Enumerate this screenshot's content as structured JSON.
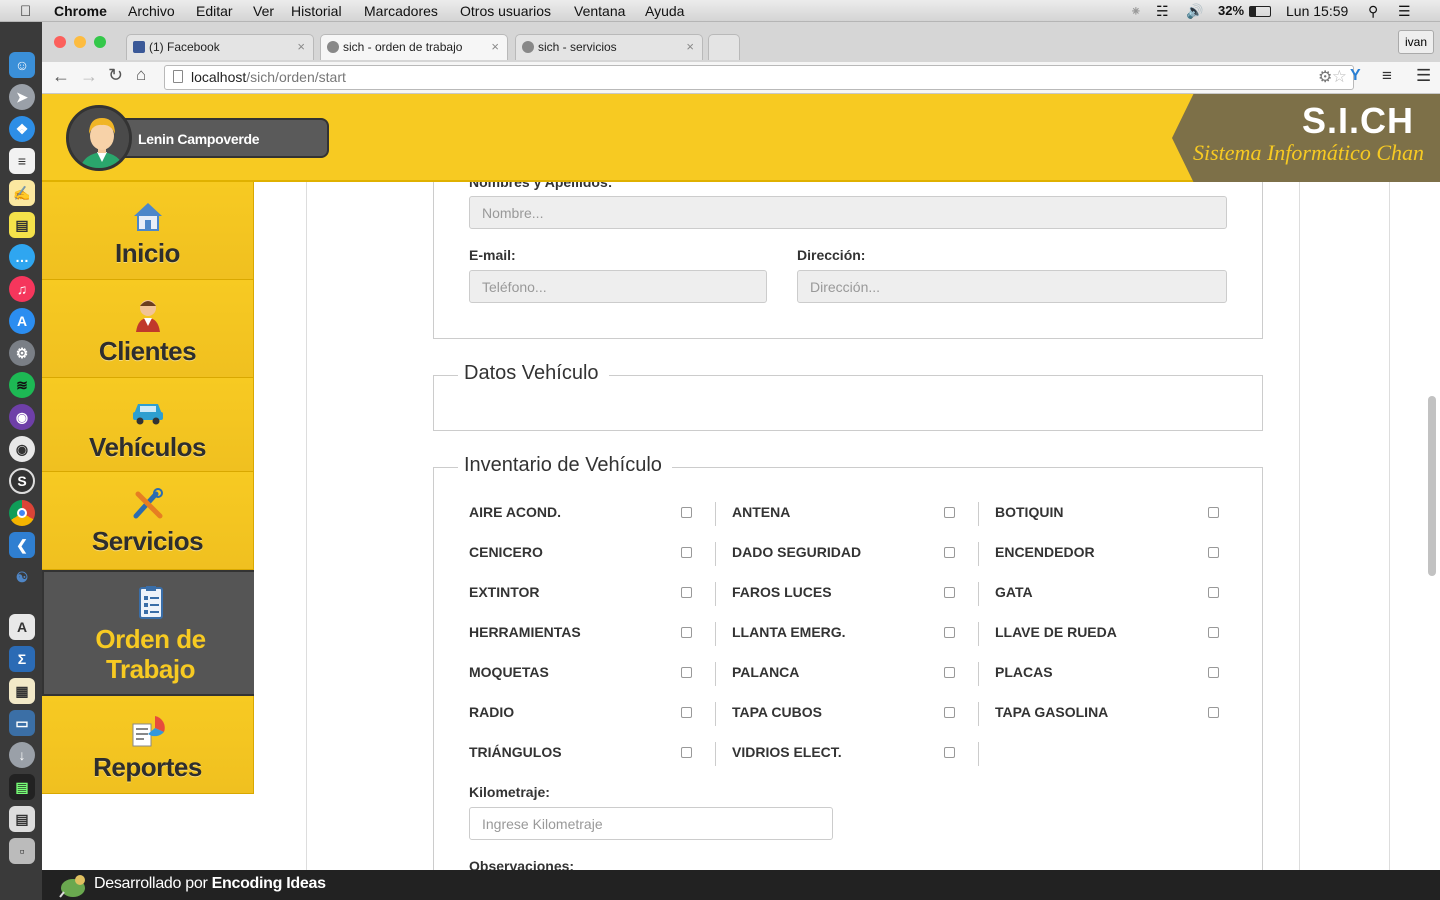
{
  "menubar": {
    "app": "Chrome",
    "menus": [
      "Archivo",
      "Editar",
      "Ver",
      "Historial",
      "Marcadores",
      "Otros usuarios",
      "Ventana",
      "Ayuda"
    ],
    "battery": "32%",
    "clock": "Lun 15:59"
  },
  "browser": {
    "tabs": [
      {
        "title": "(1) Facebook"
      },
      {
        "title": "sich - orden de trabajo"
      },
      {
        "title": "sich - servicios"
      }
    ],
    "profile": "ivan",
    "url_host": "localhost",
    "url_path": "/sich/orden/start"
  },
  "header": {
    "user_name": "Lenin Campoverde",
    "brand_title": "S.I.CH",
    "brand_subtitle": "Sistema Informático Chan"
  },
  "sidebar": {
    "items": [
      {
        "label": "Inicio"
      },
      {
        "label": "Clientes"
      },
      {
        "label": "Vehículos"
      },
      {
        "label": "Servicios"
      },
      {
        "label": "Orden de Trabajo"
      },
      {
        "label": "Reportes"
      }
    ]
  },
  "form": {
    "names_label": "Nombres y Apellidos:",
    "names_placeholder": "Nombre...",
    "email_label": "E-mail:",
    "email_placeholder": "Teléfono...",
    "address_label": "Dirección:",
    "address_placeholder": "Dirección...",
    "vehicle_legend": "Datos Vehículo",
    "inventory_legend": "Inventario de Vehículo",
    "inventory": [
      [
        "AIRE ACOND.",
        "ANTENA",
        "BOTIQUIN"
      ],
      [
        "CENICERO",
        "DADO SEGURIDAD",
        "ENCENDEDOR"
      ],
      [
        "EXTINTOR",
        "FAROS LUCES",
        "GATA"
      ],
      [
        "HERRAMIENTAS",
        "LLANTA EMERG.",
        "LLAVE DE RUEDA"
      ],
      [
        "MOQUETAS",
        "PALANCA",
        "PLACAS"
      ],
      [
        "RADIO",
        "TAPA CUBOS",
        "TAPA GASOLINA"
      ],
      [
        "TRIÁNGULOS",
        "VIDRIOS ELECT.",
        ""
      ]
    ],
    "km_label": "Kilometraje:",
    "km_placeholder": "Ingrese Kilometraje",
    "obs_label": "Observaciones:"
  },
  "footer": {
    "prefix": "Desarrollado por ",
    "company": "Encoding Ideas"
  }
}
